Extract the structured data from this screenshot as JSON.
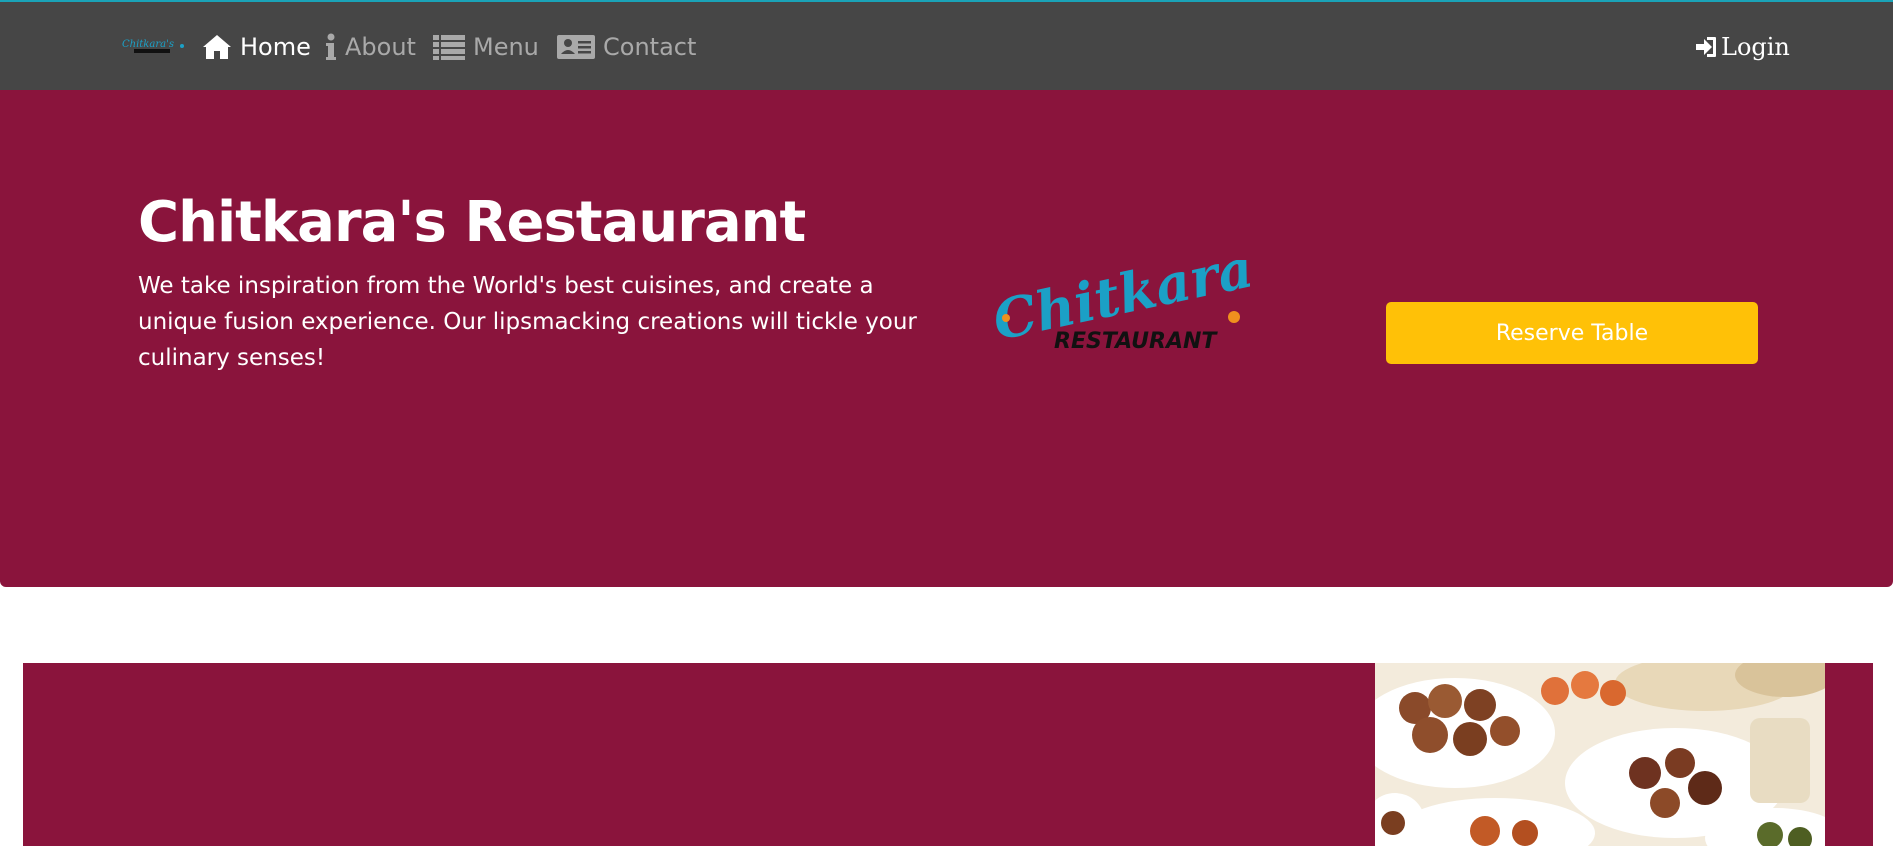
{
  "navbar": {
    "brand_name": "Chitkara's Restaurant",
    "items": [
      {
        "label": "Home",
        "icon": "home-icon",
        "active": true
      },
      {
        "label": "About",
        "icon": "info-icon",
        "active": false
      },
      {
        "label": "Menu",
        "icon": "list-icon",
        "active": false
      },
      {
        "label": "Contact",
        "icon": "address-card-icon",
        "active": false
      }
    ],
    "login_label": "Login",
    "login_icon": "sign-in-icon"
  },
  "hero": {
    "title": "Chitkara's Restaurant",
    "description": "We take inspiration from the World's best cuisines, and create a unique fusion experience. Our lipsmacking creations will tickle your culinary senses!",
    "logo_script": "Chitkara's",
    "logo_sub": "RESTAURANT",
    "reserve_label": "Reserve Table"
  },
  "colors": {
    "navbar_bg": "#464646",
    "accent_line": "#1aa3b8",
    "jumbotron_bg": "#8a143c",
    "button_bg": "#ffc107",
    "logo_teal": "#1ba0c6",
    "logo_orange": "#f0901e"
  }
}
